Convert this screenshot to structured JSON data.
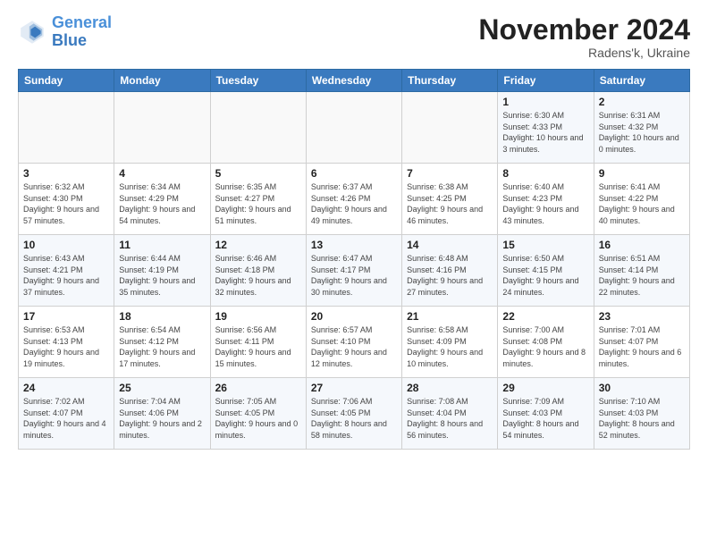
{
  "logo": {
    "line1": "General",
    "line2": "Blue"
  },
  "title": "November 2024",
  "location": "Radens'k, Ukraine",
  "days_header": [
    "Sunday",
    "Monday",
    "Tuesday",
    "Wednesday",
    "Thursday",
    "Friday",
    "Saturday"
  ],
  "weeks": [
    [
      {
        "day": "",
        "sunrise": "",
        "sunset": "",
        "daylight": ""
      },
      {
        "day": "",
        "sunrise": "",
        "sunset": "",
        "daylight": ""
      },
      {
        "day": "",
        "sunrise": "",
        "sunset": "",
        "daylight": ""
      },
      {
        "day": "",
        "sunrise": "",
        "sunset": "",
        "daylight": ""
      },
      {
        "day": "",
        "sunrise": "",
        "sunset": "",
        "daylight": ""
      },
      {
        "day": "1",
        "sunrise": "Sunrise: 6:30 AM",
        "sunset": "Sunset: 4:33 PM",
        "daylight": "Daylight: 10 hours and 3 minutes."
      },
      {
        "day": "2",
        "sunrise": "Sunrise: 6:31 AM",
        "sunset": "Sunset: 4:32 PM",
        "daylight": "Daylight: 10 hours and 0 minutes."
      }
    ],
    [
      {
        "day": "3",
        "sunrise": "Sunrise: 6:32 AM",
        "sunset": "Sunset: 4:30 PM",
        "daylight": "Daylight: 9 hours and 57 minutes."
      },
      {
        "day": "4",
        "sunrise": "Sunrise: 6:34 AM",
        "sunset": "Sunset: 4:29 PM",
        "daylight": "Daylight: 9 hours and 54 minutes."
      },
      {
        "day": "5",
        "sunrise": "Sunrise: 6:35 AM",
        "sunset": "Sunset: 4:27 PM",
        "daylight": "Daylight: 9 hours and 51 minutes."
      },
      {
        "day": "6",
        "sunrise": "Sunrise: 6:37 AM",
        "sunset": "Sunset: 4:26 PM",
        "daylight": "Daylight: 9 hours and 49 minutes."
      },
      {
        "day": "7",
        "sunrise": "Sunrise: 6:38 AM",
        "sunset": "Sunset: 4:25 PM",
        "daylight": "Daylight: 9 hours and 46 minutes."
      },
      {
        "day": "8",
        "sunrise": "Sunrise: 6:40 AM",
        "sunset": "Sunset: 4:23 PM",
        "daylight": "Daylight: 9 hours and 43 minutes."
      },
      {
        "day": "9",
        "sunrise": "Sunrise: 6:41 AM",
        "sunset": "Sunset: 4:22 PM",
        "daylight": "Daylight: 9 hours and 40 minutes."
      }
    ],
    [
      {
        "day": "10",
        "sunrise": "Sunrise: 6:43 AM",
        "sunset": "Sunset: 4:21 PM",
        "daylight": "Daylight: 9 hours and 37 minutes."
      },
      {
        "day": "11",
        "sunrise": "Sunrise: 6:44 AM",
        "sunset": "Sunset: 4:19 PM",
        "daylight": "Daylight: 9 hours and 35 minutes."
      },
      {
        "day": "12",
        "sunrise": "Sunrise: 6:46 AM",
        "sunset": "Sunset: 4:18 PM",
        "daylight": "Daylight: 9 hours and 32 minutes."
      },
      {
        "day": "13",
        "sunrise": "Sunrise: 6:47 AM",
        "sunset": "Sunset: 4:17 PM",
        "daylight": "Daylight: 9 hours and 30 minutes."
      },
      {
        "day": "14",
        "sunrise": "Sunrise: 6:48 AM",
        "sunset": "Sunset: 4:16 PM",
        "daylight": "Daylight: 9 hours and 27 minutes."
      },
      {
        "day": "15",
        "sunrise": "Sunrise: 6:50 AM",
        "sunset": "Sunset: 4:15 PM",
        "daylight": "Daylight: 9 hours and 24 minutes."
      },
      {
        "day": "16",
        "sunrise": "Sunrise: 6:51 AM",
        "sunset": "Sunset: 4:14 PM",
        "daylight": "Daylight: 9 hours and 22 minutes."
      }
    ],
    [
      {
        "day": "17",
        "sunrise": "Sunrise: 6:53 AM",
        "sunset": "Sunset: 4:13 PM",
        "daylight": "Daylight: 9 hours and 19 minutes."
      },
      {
        "day": "18",
        "sunrise": "Sunrise: 6:54 AM",
        "sunset": "Sunset: 4:12 PM",
        "daylight": "Daylight: 9 hours and 17 minutes."
      },
      {
        "day": "19",
        "sunrise": "Sunrise: 6:56 AM",
        "sunset": "Sunset: 4:11 PM",
        "daylight": "Daylight: 9 hours and 15 minutes."
      },
      {
        "day": "20",
        "sunrise": "Sunrise: 6:57 AM",
        "sunset": "Sunset: 4:10 PM",
        "daylight": "Daylight: 9 hours and 12 minutes."
      },
      {
        "day": "21",
        "sunrise": "Sunrise: 6:58 AM",
        "sunset": "Sunset: 4:09 PM",
        "daylight": "Daylight: 9 hours and 10 minutes."
      },
      {
        "day": "22",
        "sunrise": "Sunrise: 7:00 AM",
        "sunset": "Sunset: 4:08 PM",
        "daylight": "Daylight: 9 hours and 8 minutes."
      },
      {
        "day": "23",
        "sunrise": "Sunrise: 7:01 AM",
        "sunset": "Sunset: 4:07 PM",
        "daylight": "Daylight: 9 hours and 6 minutes."
      }
    ],
    [
      {
        "day": "24",
        "sunrise": "Sunrise: 7:02 AM",
        "sunset": "Sunset: 4:07 PM",
        "daylight": "Daylight: 9 hours and 4 minutes."
      },
      {
        "day": "25",
        "sunrise": "Sunrise: 7:04 AM",
        "sunset": "Sunset: 4:06 PM",
        "daylight": "Daylight: 9 hours and 2 minutes."
      },
      {
        "day": "26",
        "sunrise": "Sunrise: 7:05 AM",
        "sunset": "Sunset: 4:05 PM",
        "daylight": "Daylight: 9 hours and 0 minutes."
      },
      {
        "day": "27",
        "sunrise": "Sunrise: 7:06 AM",
        "sunset": "Sunset: 4:05 PM",
        "daylight": "Daylight: 8 hours and 58 minutes."
      },
      {
        "day": "28",
        "sunrise": "Sunrise: 7:08 AM",
        "sunset": "Sunset: 4:04 PM",
        "daylight": "Daylight: 8 hours and 56 minutes."
      },
      {
        "day": "29",
        "sunrise": "Sunrise: 7:09 AM",
        "sunset": "Sunset: 4:03 PM",
        "daylight": "Daylight: 8 hours and 54 minutes."
      },
      {
        "day": "30",
        "sunrise": "Sunrise: 7:10 AM",
        "sunset": "Sunset: 4:03 PM",
        "daylight": "Daylight: 8 hours and 52 minutes."
      }
    ]
  ]
}
